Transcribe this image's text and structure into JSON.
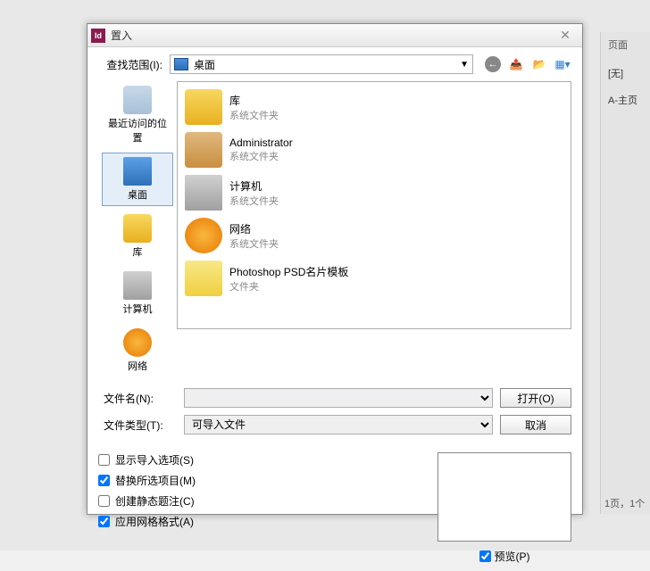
{
  "dialog": {
    "title": "置入",
    "lookin_label": "查找范围(I):",
    "lookin_value": "桌面",
    "sidebar": [
      {
        "label": "最近访问的位置",
        "icon": "recent"
      },
      {
        "label": "桌面",
        "icon": "desktop",
        "selected": true
      },
      {
        "label": "库",
        "icon": "lib"
      },
      {
        "label": "计算机",
        "icon": "computer"
      },
      {
        "label": "网络",
        "icon": "network"
      }
    ],
    "files": [
      {
        "name": "库",
        "sub": "系统文件夹",
        "icon": "lib"
      },
      {
        "name": "Administrator",
        "sub": "系统文件夹",
        "icon": "user"
      },
      {
        "name": "计算机",
        "sub": "系统文件夹",
        "icon": "computer"
      },
      {
        "name": "网络",
        "sub": "系统文件夹",
        "icon": "network"
      },
      {
        "name": "Photoshop PSD名片模板",
        "sub": "文件夹",
        "icon": "folder"
      }
    ],
    "filename_label": "文件名(N):",
    "filetype_label": "文件类型(T):",
    "filetype_value": "可导入文件",
    "open_btn": "打开(O)",
    "cancel_btn": "取消",
    "options": {
      "show_import": "显示导入选项(S)",
      "replace_sel": "替换所选项目(M)",
      "create_static": "创建静态题注(C)",
      "apply_grid": "应用网格格式(A)",
      "preview": "预览(P)"
    }
  },
  "right_panel": {
    "tab": "页面",
    "none": "[无]",
    "master": "A-主页",
    "footer": "1页，1个"
  }
}
